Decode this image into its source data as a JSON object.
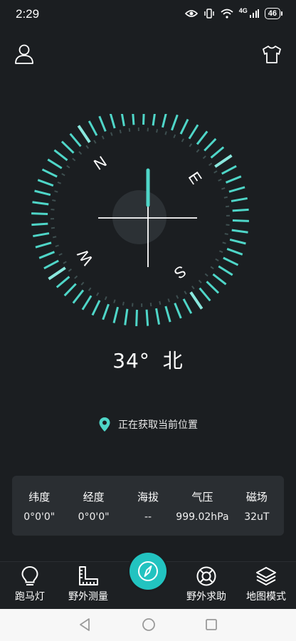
{
  "status_bar": {
    "time": "2:29",
    "battery": "46",
    "network": "4G"
  },
  "header": {
    "profile_icon": "user-icon",
    "theme_icon": "tshirt-icon"
  },
  "compass": {
    "labels": {
      "n": "N",
      "e": "E",
      "s": "S",
      "w": "W"
    },
    "accent": "#4fd6c8",
    "dim_tick": "#3e4f50",
    "heading_degrees": 34
  },
  "heading": {
    "degrees": "34°",
    "direction": "北"
  },
  "location": {
    "status_text": "正在获取当前位置",
    "icon": "location-pin-icon"
  },
  "info_panel": {
    "items": [
      {
        "label": "纬度",
        "value": "0°0'0\""
      },
      {
        "label": "经度",
        "value": "0°0'0\""
      },
      {
        "label": "海拔",
        "value": "--"
      },
      {
        "label": "气压",
        "value": "999.02hPa"
      },
      {
        "label": "磁场",
        "value": "32uT"
      }
    ]
  },
  "bottom_nav": {
    "items": [
      {
        "label": "跑马灯",
        "icon": "lightbulb-icon"
      },
      {
        "label": "野外测量",
        "icon": "ruler-icon"
      },
      {
        "label": "野外求助",
        "icon": "lifebuoy-icon"
      },
      {
        "label": "地图模式",
        "icon": "layers-icon"
      }
    ],
    "center_icon": "compass-icon",
    "center_color": "#22c3c0"
  }
}
